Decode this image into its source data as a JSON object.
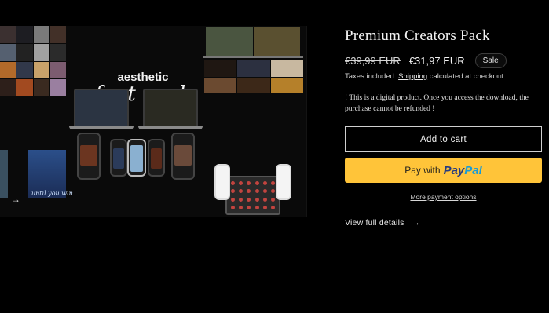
{
  "product": {
    "title": "Premium Creators Pack",
    "price_regular": "€39,99 EUR",
    "price_sale": "€31,97 EUR",
    "sale_badge": "Sale",
    "tax_before": "Taxes included.",
    "tax_link": "Shipping",
    "tax_after": "calculated at checkout.",
    "notice": "! This is a digital product. Once you access the download, the purchase cannot be refunded !"
  },
  "media": {
    "headline_line1": "aesthetic",
    "headline_line2": "font pack",
    "overlay_text": "until you win"
  },
  "buttons": {
    "add_to_cart": "Add to cart",
    "pay_with": "Pay with",
    "paypal_part1": "Pay",
    "paypal_part2": "Pal",
    "more_payment": "More payment options"
  },
  "links": {
    "view_details": "View full details",
    "view_details_icon": "arrow-right-icon"
  },
  "colors": {
    "background": "#000000",
    "paypal_yellow": "#ffc439",
    "paypal_dark_blue": "#253b80",
    "paypal_light_blue": "#179bd7"
  }
}
